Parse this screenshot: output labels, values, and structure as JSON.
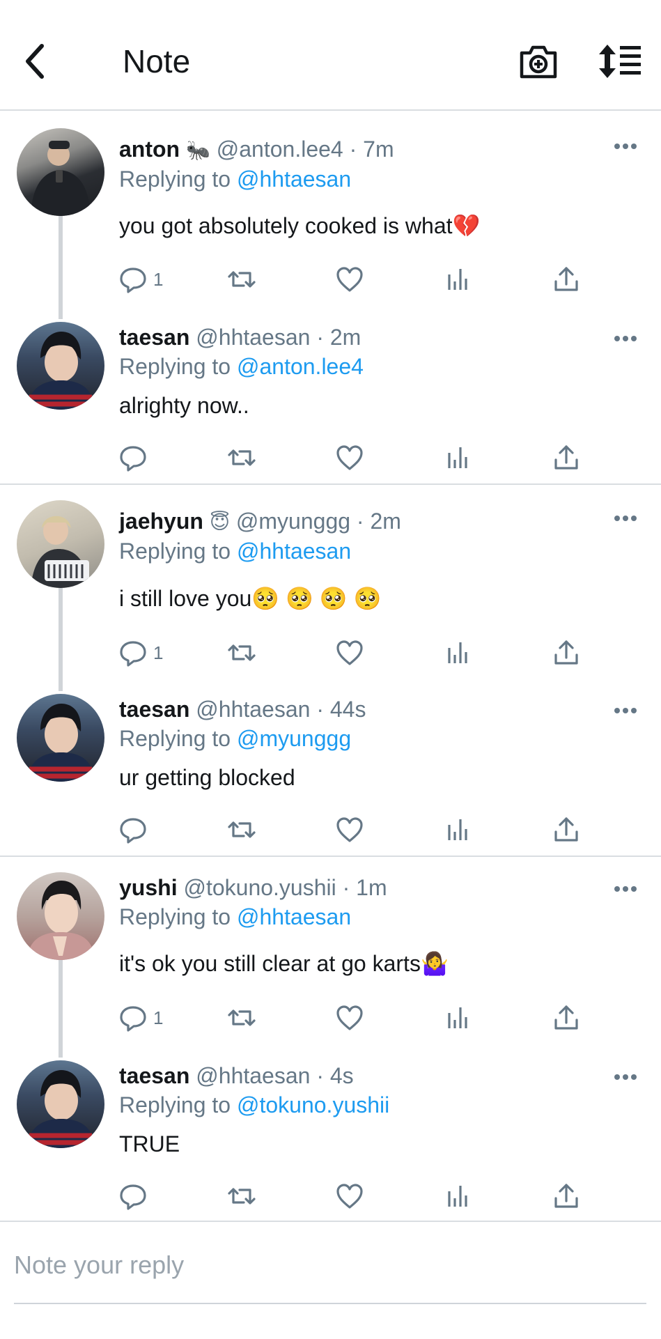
{
  "header": {
    "title": "Note"
  },
  "tweets": [
    {
      "name": "anton",
      "name_emoji": "🐜",
      "handle": "@anton.lee4",
      "time": "· 7m",
      "replying_label": "Replying to",
      "replying_handle": "@hhtaesan",
      "text": "you got absolutely cooked is what💔",
      "reply_count": "1",
      "avatar_color": "#3a3f46"
    },
    {
      "name": "taesan",
      "name_emoji": "",
      "handle": "@hhtaesan",
      "time": "· 2m",
      "replying_label": "Replying to",
      "replying_handle": "@anton.lee4",
      "text": "alrighty now..",
      "reply_count": "",
      "avatar_color": "#1e2f4d"
    },
    {
      "name": "jaehyun",
      "name_emoji": "😇",
      "handle": "@myunggg",
      "time": "· 2m",
      "replying_label": "Replying to",
      "replying_handle": "@hhtaesan",
      "text": "i still love you🥺 🥺 🥺 🥺",
      "reply_count": "1",
      "avatar_color": "#c9c4b6"
    },
    {
      "name": "taesan",
      "name_emoji": "",
      "handle": "@hhtaesan",
      "time": "· 44s",
      "replying_label": "Replying to",
      "replying_handle": "@myunggg",
      "text": "ur getting blocked",
      "reply_count": "",
      "avatar_color": "#1e2f4d"
    },
    {
      "name": "yushi",
      "name_emoji": "",
      "handle": "@tokuno.yushii",
      "time": "· 1m",
      "replying_label": "Replying to",
      "replying_handle": "@hhtaesan",
      "text": "it's ok you still clear at go karts🤷‍♀️",
      "reply_count": "1",
      "avatar_color": "#b89a94"
    },
    {
      "name": "taesan",
      "name_emoji": "",
      "handle": "@hhtaesan",
      "time": "· 4s",
      "replying_label": "Replying to",
      "replying_handle": "@tokuno.yushii",
      "text": "TRUE",
      "reply_count": "",
      "avatar_color": "#1e2f4d"
    }
  ],
  "reply": {
    "placeholder": "Note your reply"
  },
  "colors": {
    "link": "#1d9bf0",
    "secondary": "#657786",
    "divider": "#d9dde1"
  },
  "icons": [
    "back-chevron-icon",
    "camera-plus-icon",
    "sort-icon",
    "more-icon",
    "reply-icon",
    "retweet-icon",
    "like-icon",
    "views-icon",
    "share-icon"
  ]
}
